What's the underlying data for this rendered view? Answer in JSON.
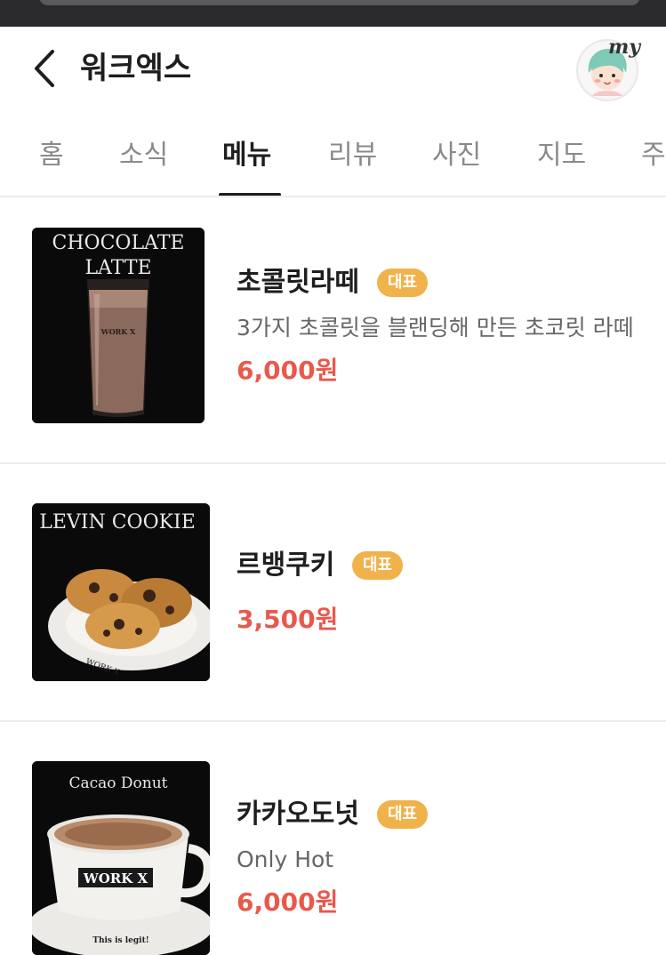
{
  "header": {
    "title": "워크엑스",
    "my_label": "my"
  },
  "tabs": [
    {
      "label": "홈"
    },
    {
      "label": "소식"
    },
    {
      "label": "메뉴"
    },
    {
      "label": "리뷰"
    },
    {
      "label": "사진"
    },
    {
      "label": "지도"
    },
    {
      "label": "주"
    }
  ],
  "active_tab": "메뉴",
  "menu": {
    "items": [
      {
        "image_caption": [
          "CHOCOLATE",
          "LATTE"
        ],
        "image_brand": "WORK X",
        "name": "초콜릿라떼",
        "badge": "대표",
        "description": "3가지 초콜릿을 블랜딩해 만든 초코릿 라떼",
        "price": "6,000원"
      },
      {
        "image_caption": [
          "LEVIN COOKIE"
        ],
        "image_brand": "WORK X",
        "name": "르뱅쿠키",
        "badge": "대표",
        "description": "",
        "price": "3,500원"
      },
      {
        "image_caption": [
          "Cacao Donut"
        ],
        "image_brand": "WORK X",
        "image_footer": "This is legit!",
        "name": "카카오도넛",
        "badge": "대표",
        "description": "Only Hot",
        "price": "6,000원"
      }
    ]
  },
  "colors": {
    "price": "#e8594c",
    "badge": "#f0b24a",
    "active_tab": "#1e1e1e",
    "inactive_tab": "#8a8a8a"
  }
}
